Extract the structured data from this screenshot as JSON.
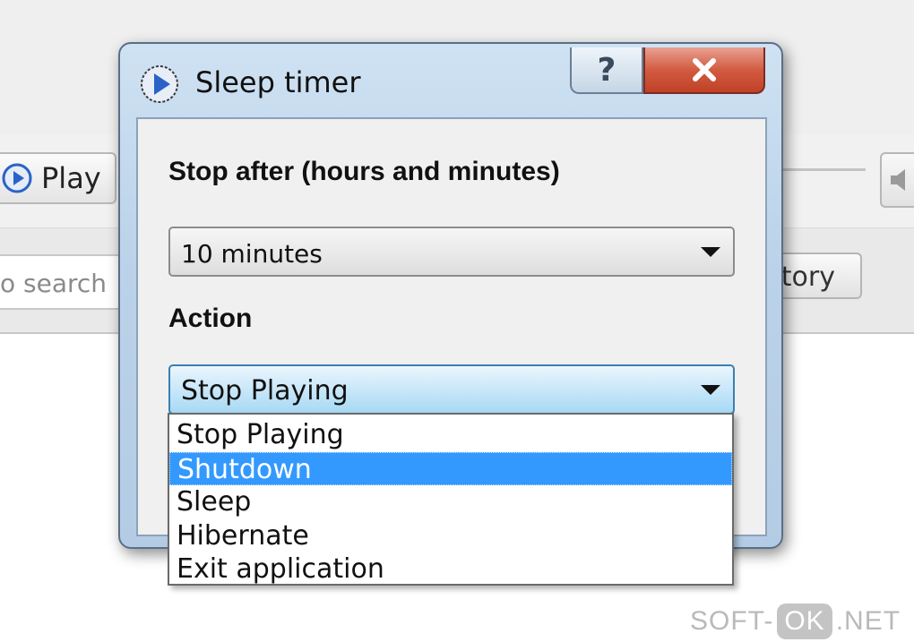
{
  "background": {
    "play_label": "Play",
    "search_placeholder": "o search",
    "history_label": "tory"
  },
  "dialog": {
    "title": "Sleep timer",
    "help_label": "?",
    "close_icon": "close-icon",
    "duration_label": "Stop after (hours and minutes)",
    "duration_value": "10 minutes",
    "action_label": "Action",
    "action_value": "Stop Playing",
    "action_options": [
      "Stop Playing",
      "Shutdown",
      "Sleep",
      "Hibernate",
      "Exit application"
    ],
    "highlighted_option": "Shutdown"
  },
  "watermark": {
    "prefix": "SOFT-",
    "mid": "OK",
    "suffix": ".NET"
  },
  "colors": {
    "accent": "#3399ff",
    "close": "#c8472d",
    "play_icon": "#2a62c8"
  }
}
